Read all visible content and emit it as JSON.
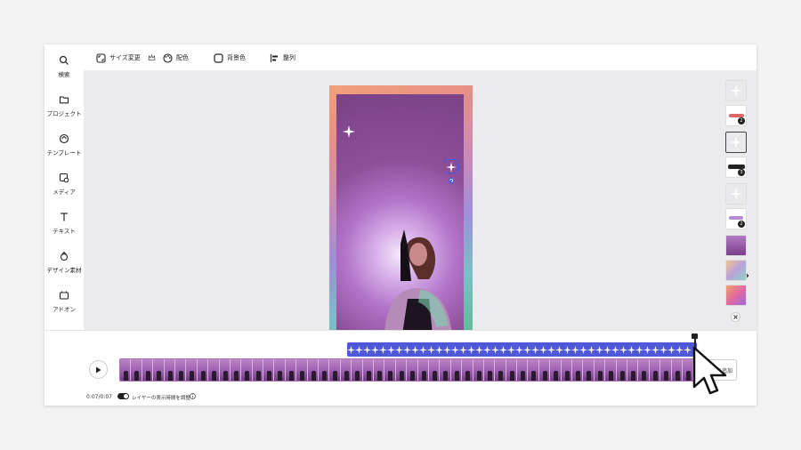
{
  "sidebar": {
    "items": [
      {
        "label": "検索",
        "icon": "search-icon"
      },
      {
        "label": "プロジェクト",
        "icon": "folder-icon"
      },
      {
        "label": "テンプレート",
        "icon": "template-icon"
      },
      {
        "label": "メディア",
        "icon": "media-icon"
      },
      {
        "label": "テキスト",
        "icon": "text-icon"
      },
      {
        "label": "デザイン素材",
        "icon": "elements-icon"
      },
      {
        "label": "アドオン",
        "icon": "addon-icon"
      }
    ]
  },
  "toolbar": {
    "resize_label": "サイズ変更",
    "color_label": "配色",
    "background_label": "背景色",
    "align_label": "整列"
  },
  "timeline": {
    "time_display": "0:07/0:07",
    "toggle_label": "レイヤーの表示時間を調整",
    "add_button_label": "ッシンを追加"
  },
  "thumbnails": [
    {
      "badge": ""
    },
    {
      "badge": "2"
    },
    {
      "badge": ""
    },
    {
      "badge": "3"
    },
    {
      "badge": ""
    },
    {
      "badge": "2"
    },
    {
      "badge": ""
    },
    {
      "badge": ""
    },
    {
      "badge": ""
    }
  ],
  "colors": {
    "accent": "#4f58d8",
    "sidebar_bg": "#ffffff",
    "stage_bg": "#ebebed"
  }
}
